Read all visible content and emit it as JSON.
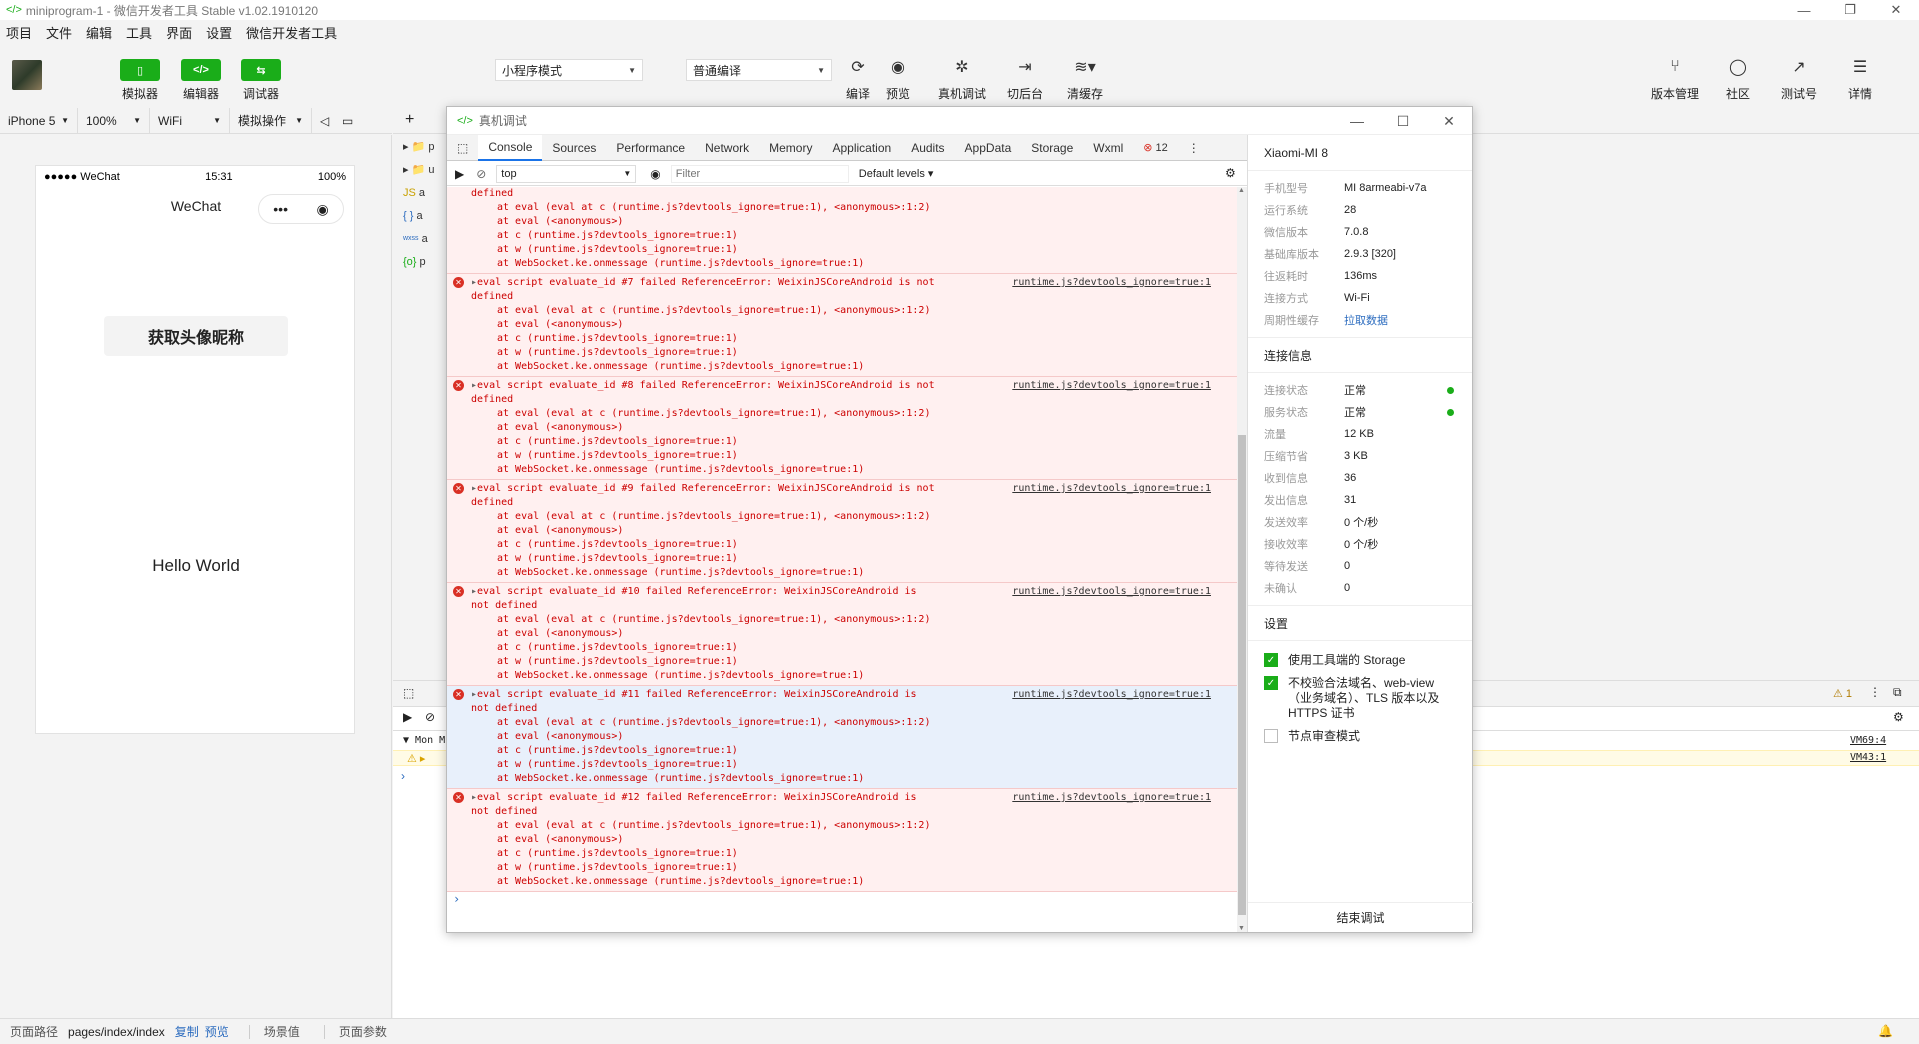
{
  "window": {
    "title": "miniprogram-1 - 微信开发者工具 Stable v1.02.1910120",
    "logo": "</>",
    "min": "—",
    "max": "❐",
    "close": "✕"
  },
  "menu": [
    "项目",
    "文件",
    "编辑",
    "工具",
    "界面",
    "设置",
    "微信开发者工具"
  ],
  "toolbar": {
    "simulator": "模拟器",
    "editor": "编辑器",
    "debugger": "调试器",
    "mode_select": "小程序模式",
    "compile_select": "普通编译",
    "compile": "编译",
    "preview": "预览",
    "remote_debug": "真机调试",
    "background": "切后台",
    "clear_cache": "清缓存",
    "version": "版本管理",
    "community": "社区",
    "test": "测试号",
    "details": "详情"
  },
  "devicebar": {
    "device": "iPhone 5",
    "zoom": "100%",
    "network": "WiFi",
    "ops": "模拟操作"
  },
  "phone": {
    "signal": "●●●●● WeChat",
    "time": "15:31",
    "battery": "100%",
    "nav_title": "WeChat",
    "capsule_more": "•••",
    "capsule_close": "◉",
    "avatar_button": "获取头像昵称",
    "hello": "Hello World"
  },
  "filetree": [
    {
      "icon": "▸ 📁",
      "label": "p"
    },
    {
      "icon": "▸ 📁",
      "label": "u"
    },
    {
      "icon": "JS",
      "label": "a"
    },
    {
      "icon": "{ }",
      "label": "a"
    },
    {
      "icon": "wxss",
      "label": "a"
    },
    {
      "icon": "{o}",
      "label": "p"
    }
  ],
  "devtools": {
    "title": "真机调试",
    "tabs": [
      "Console",
      "Sources",
      "Performance",
      "Network",
      "Memory",
      "Application",
      "Audits",
      "AppData",
      "Storage",
      "Wxml"
    ],
    "error_count": "12",
    "context": "top",
    "filter_placeholder": "Filter",
    "levels": "Default levels",
    "first_stack_head": "defined",
    "entries": [
      {
        "id": "#7",
        "msg1": "eval script evaluate_id #7 failed ReferenceError: WeixinJSCoreAndroid is not",
        "msg2": "defined"
      },
      {
        "id": "#8",
        "msg1": "eval script evaluate_id #8 failed ReferenceError: WeixinJSCoreAndroid is not",
        "msg2": "defined"
      },
      {
        "id": "#9",
        "msg1": "eval script evaluate_id #9 failed ReferenceError: WeixinJSCoreAndroid is not",
        "msg2": "defined"
      },
      {
        "id": "#10",
        "msg1": "eval script evaluate_id #10 failed ReferenceError: WeixinJSCoreAndroid is",
        "msg2": "not defined"
      },
      {
        "id": "#11",
        "msg1": "eval script evaluate_id #11 failed ReferenceError: WeixinJSCoreAndroid is",
        "msg2": "not defined"
      },
      {
        "id": "#12",
        "msg1": "eval script evaluate_id #12 failed ReferenceError: WeixinJSCoreAndroid is",
        "msg2": "not defined"
      }
    ],
    "source": "runtime.js?devtools_ignore=true:1",
    "stack": [
      "at eval (eval at c (runtime.js?devtools_ignore=true:1), <anonymous>:1:2)",
      "at eval (<anonymous>)",
      "at c (runtime.js?devtools_ignore=true:1)",
      "at w (runtime.js?devtools_ignore=true:1)",
      "at WebSocket.ke.onmessage (runtime.js?devtools_ignore=true:1)"
    ],
    "prompt": "›"
  },
  "info": {
    "device": "Xiaomi-MI 8",
    "rows": [
      {
        "k": "手机型号",
        "v": "MI 8armeabi-v7a"
      },
      {
        "k": "运行系统",
        "v": "28"
      },
      {
        "k": "微信版本",
        "v": "7.0.8"
      },
      {
        "k": "基础库版本",
        "v": "2.9.3 [320]"
      },
      {
        "k": "往返耗时",
        "v": "136ms"
      },
      {
        "k": "连接方式",
        "v": "Wi-Fi"
      },
      {
        "k": "周期性缓存",
        "v": "拉取数据"
      }
    ],
    "conn_title": "连接信息",
    "conn": [
      {
        "k": "连接状态",
        "v": "正常"
      },
      {
        "k": "服务状态",
        "v": "正常"
      },
      {
        "k": "流量",
        "v": "12 KB"
      },
      {
        "k": "压缩节省",
        "v": "3 KB"
      },
      {
        "k": "收到信息",
        "v": "36"
      },
      {
        "k": "发出信息",
        "v": "31"
      },
      {
        "k": "发送效率",
        "v": "0 个/秒"
      },
      {
        "k": "接收效率",
        "v": "0 个/秒"
      },
      {
        "k": "等待发送",
        "v": "0"
      },
      {
        "k": "未确认",
        "v": "0"
      }
    ],
    "settings_title": "设置",
    "settings": [
      {
        "label": "使用工具端的 Storage",
        "checked": true
      },
      {
        "label": "不校验合法域名、web-view（业务域名）、TLS 版本以及 HTTPS 证书",
        "checked": true
      },
      {
        "label": "节点审查模式",
        "checked": false
      }
    ],
    "end": "结束调试"
  },
  "bottom_console": {
    "group": "Mon M",
    "warn_count": "1",
    "vm1": "VM69:4",
    "vm2": "VM43:1"
  },
  "statusbar": {
    "path_label": "页面路径",
    "path": "pages/index/index",
    "copy": "复制",
    "preview": "预览",
    "scene": "场景值",
    "params": "页面参数"
  }
}
